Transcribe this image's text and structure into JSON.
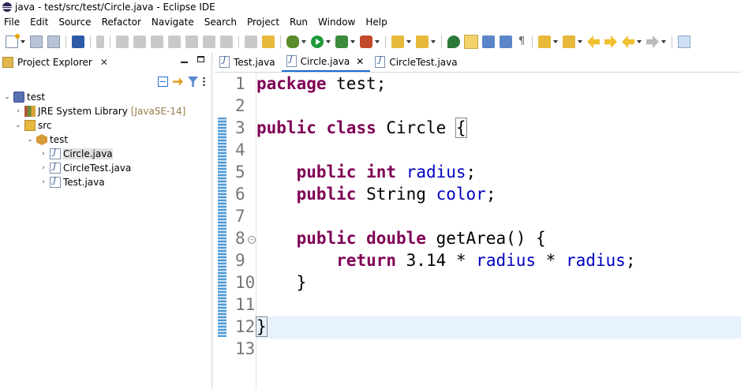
{
  "window": {
    "title": "java - test/src/test/Circle.java - Eclipse IDE"
  },
  "menu": [
    "File",
    "Edit",
    "Source",
    "Refactor",
    "Navigate",
    "Search",
    "Project",
    "Run",
    "Window",
    "Help"
  ],
  "project_explorer": {
    "title": "Project Explorer",
    "tree": [
      {
        "label": "test",
        "extra": ""
      },
      {
        "label": "JRE System Library",
        "extra": "[JavaSE-14]"
      },
      {
        "label": "src",
        "extra": ""
      },
      {
        "label": "test",
        "extra": ""
      },
      {
        "label": "Circle.java",
        "extra": ""
      },
      {
        "label": "CircleTest.java",
        "extra": ""
      },
      {
        "label": "Test.java",
        "extra": ""
      }
    ]
  },
  "editor": {
    "tabs": [
      "Test.java",
      "Circle.java",
      "CircleTest.java"
    ],
    "active_tab": "Circle.java",
    "line_numbers": [
      "1",
      "2",
      "3",
      "4",
      "5",
      "6",
      "7",
      "8",
      "9",
      "10",
      "11",
      "12",
      "13"
    ],
    "code": {
      "l1_kw": "package",
      "l1_rest": " test;",
      "l3_kw1": "public",
      "l3_kw2": "class",
      "l3_name": " Circle ",
      "l3_brace": "{",
      "l5_kw1": "public",
      "l5_kw2": "int",
      "l5_fld": "radius",
      "l5_end": ";",
      "l6_kw1": "public",
      "l6_type": " String ",
      "l6_fld": "color",
      "l6_end": ";",
      "l8_kw1": "public",
      "l8_kw2": "double",
      "l8_rest": " getArea() {",
      "l9_kw": "return",
      "l9_num": " 3.14 * ",
      "l9_fld1": "radius",
      "l9_op": " * ",
      "l9_fld2": "radius",
      "l9_end": ";",
      "l10": "}",
      "l12": "}"
    }
  }
}
